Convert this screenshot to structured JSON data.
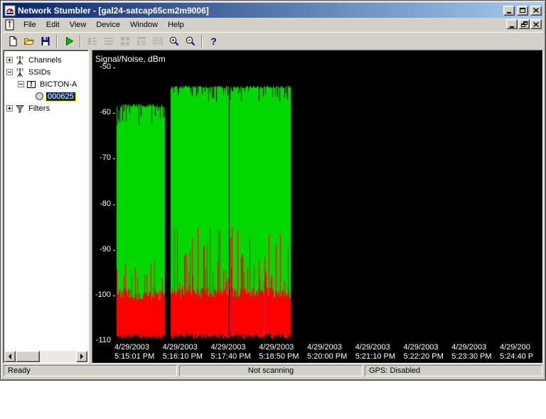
{
  "window": {
    "title": "Network Stumbler - [gal24-satcap65cm2m9006]"
  },
  "menu": {
    "items": [
      "File",
      "Edit",
      "View",
      "Device",
      "Window",
      "Help"
    ]
  },
  "toolbar": {
    "buttons": [
      "new-file",
      "open-file",
      "save-file",
      "scan",
      "view-1",
      "view-2",
      "view-3",
      "view-4",
      "grid-view",
      "zoom-in",
      "zoom-out",
      "help"
    ],
    "help_glyph": "?"
  },
  "tree": {
    "items": [
      {
        "label": "Channels",
        "state": "collapsed"
      },
      {
        "label": "SSIDs",
        "state": "expanded"
      },
      {
        "label": "BICTON-A",
        "state": "expanded"
      },
      {
        "label": "000625",
        "selected": true
      },
      {
        "label": "Filters",
        "state": "collapsed"
      }
    ]
  },
  "chart_data": {
    "type": "area",
    "title": "Signal/Noise, dBm",
    "ylabel": "dBm",
    "y_ticks": [
      -50,
      -60,
      -70,
      -80,
      -90,
      -100,
      -110
    ],
    "ylim": [
      -110,
      -50
    ],
    "x_tick_labels": [
      {
        "date": "4/29/2003",
        "time": "5:15:01 PM"
      },
      {
        "date": "4/29/2003",
        "time": "5:16:10 PM"
      },
      {
        "date": "4/29/2003",
        "time": "5:17:40 PM"
      },
      {
        "date": "4/29/2003",
        "time": "5:18:50 PM"
      },
      {
        "date": "4/29/2003",
        "time": "5:20:00 PM"
      },
      {
        "date": "4/29/2003",
        "time": "5:21:10 PM"
      },
      {
        "date": "4/29/2003",
        "time": "5:22:20 PM"
      },
      {
        "date": "4/29/2003",
        "time": "5:23:30 PM"
      },
      {
        "date": "4/29/200",
        "time": "5:24:40 P"
      }
    ],
    "background_color": "#000000",
    "text_color": "#ffffff",
    "signal_color": "#00d800",
    "noise_color": "#fe0000",
    "noise_floor_dbm": -109,
    "segments": [
      {
        "x_start_frac": 0.008,
        "x_end_frac": 0.118,
        "signal_dbm": -58,
        "signal_jitter_dbm": 2.5,
        "noise_dbm": -100,
        "noise_spike_max_dbm": -91,
        "spike_prob": 0.3
      },
      {
        "x_start_frac": 0.134,
        "x_end_frac": 0.41,
        "signal_dbm": -54,
        "signal_jitter_dbm": 1.8,
        "noise_dbm": -99.5,
        "noise_spike_max_dbm": -85,
        "spike_prob": 0.38
      }
    ],
    "marker_lines": [
      {
        "x_frac": 0.268,
        "color": "#000040",
        "from_dbm": -54,
        "to_dbm": -109
      },
      {
        "x_frac": 0.35,
        "color": "#5050b0",
        "from_dbm": -97,
        "to_dbm": -109
      }
    ]
  },
  "status": {
    "left": "Ready",
    "middle": "Not scanning",
    "right": "GPS: Disabled"
  }
}
